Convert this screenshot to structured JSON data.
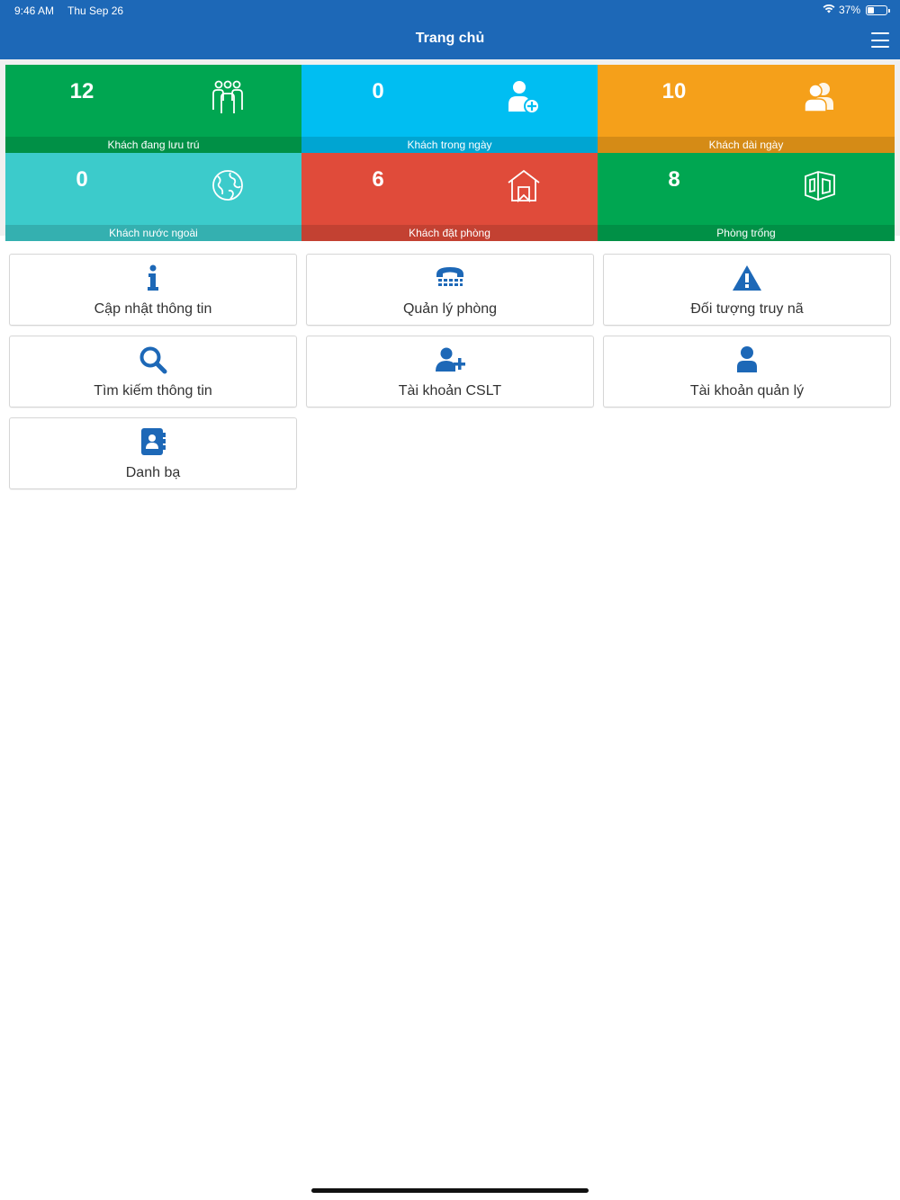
{
  "status_bar": {
    "time": "9:46 AM",
    "date": "Thu Sep 26",
    "battery": "37%",
    "battery_level": 0.37
  },
  "header": {
    "title": "Trang chủ"
  },
  "colors": {
    "header": "#1d68b7",
    "tile_green": "#00a651",
    "tile_cyan": "#00bef2",
    "tile_orange": "#f5a01a",
    "tile_teal": "#3ccbcb",
    "tile_red": "#e04b3a",
    "card_icon": "#1d68b7"
  },
  "tiles": [
    {
      "count": "12",
      "label": "Khách đang lưu trú",
      "icon": "group-icon"
    },
    {
      "count": "0",
      "label": "Khách trong ngày",
      "icon": "add-user-icon"
    },
    {
      "count": "10",
      "label": "Khách dài ngày",
      "icon": "users-icon"
    },
    {
      "count": "0",
      "label": "Khách nước ngoài",
      "icon": "globe-icon"
    },
    {
      "count": "6",
      "label": "Khách đặt phòng",
      "icon": "house-icon"
    },
    {
      "count": "8",
      "label": "Phòng trống",
      "icon": "room-icon"
    }
  ],
  "menu": [
    {
      "label": "Cập nhật thông tin",
      "icon": "info-icon"
    },
    {
      "label": "Quản lý phòng",
      "icon": "phone-icon"
    },
    {
      "label": "Đối tượng truy nã",
      "icon": "warning-icon"
    },
    {
      "label": "Tìm kiếm thông tin",
      "icon": "search-icon"
    },
    {
      "label": "Tài khoản CSLT",
      "icon": "user-plus-icon"
    },
    {
      "label": "Tài khoản quản lý",
      "icon": "user-icon"
    },
    {
      "label": "Danh bạ",
      "icon": "contacts-icon"
    }
  ]
}
